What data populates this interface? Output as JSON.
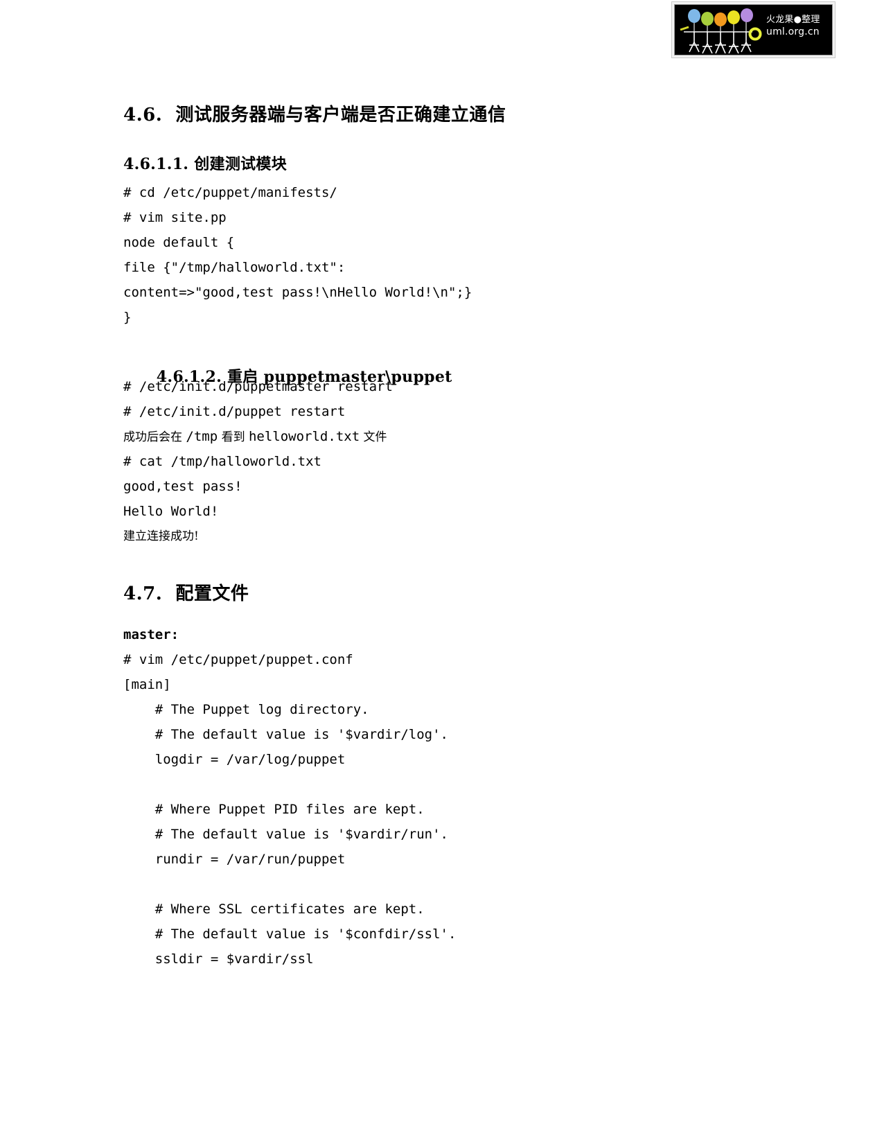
{
  "watermark": {
    "name": "huolongguo-uml-logo",
    "line1": "火龙果●整理",
    "line2": "uml.org.cn",
    "balloon_colors": [
      "#7fb8e8",
      "#a8cf3c",
      "#f29a1e",
      "#ece222",
      "#b58ce0"
    ],
    "ring_color": "#e8f03a",
    "background": "#000000"
  },
  "document": {
    "section_4_6": {
      "heading": "4.6.  测试服务器端与客户端是否正确建立通信",
      "sub_4_6_1_1": {
        "heading": "4.6.1.1. 创建测试模块",
        "code_lines": [
          "# cd /etc/puppet/manifests/",
          "# vim site.pp",
          "node default {",
          "file {\"/tmp/halloworld.txt\":",
          "content=>\"good,test pass!\\nHello World!\\n\";}",
          "}"
        ]
      },
      "sub_4_6_1_2": {
        "heading_num": "4.6.1.2. ",
        "heading_cn": "重启 ",
        "heading_en": "puppetmaster\\puppet",
        "heading_full": "4.6.1.2. 重启 puppetmaster\\puppet",
        "code_lines_a": [
          "# /etc/init.d/puppetmaster restart",
          "# /etc/init.d/puppet restart"
        ],
        "note_1_a": "成功后会在 ",
        "note_1_b": "/tmp",
        "note_1_c": " 看到 ",
        "note_1_d": "helloworld.txt",
        "note_1_e": " 文件",
        "code_lines_b": [
          "# cat /tmp/halloworld.txt",
          "good,test pass!",
          "Hello World!"
        ],
        "note_2": "建立连接成功!"
      }
    },
    "section_4_7": {
      "heading": "4.7.  配置文件",
      "label_master": "master:",
      "config_lines": [
        "# vim /etc/puppet/puppet.conf",
        "[main]",
        "    # The Puppet log directory.",
        "    # The default value is '$vardir/log'.",
        "    logdir = /var/log/puppet",
        "",
        "    # Where Puppet PID files are kept.",
        "    # The default value is '$vardir/run'.",
        "    rundir = /var/run/puppet",
        "",
        "    # Where SSL certificates are kept.",
        "    # The default value is '$confdir/ssl'.",
        "    ssldir = $vardir/ssl"
      ]
    }
  }
}
